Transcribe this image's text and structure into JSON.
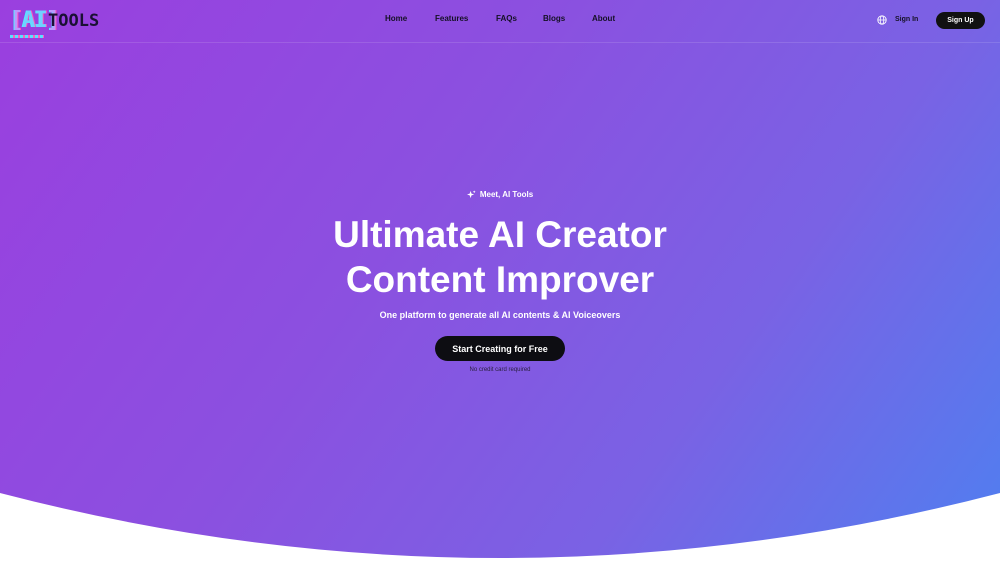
{
  "header": {
    "logo": {
      "mark": "AI",
      "text": "TOOLS"
    },
    "nav": [
      {
        "label": "Home"
      },
      {
        "label": "Features"
      },
      {
        "label": "FAQs"
      },
      {
        "label": "Blogs"
      },
      {
        "label": "About"
      }
    ],
    "language_icon": "globe-icon",
    "sign_in_label": "Sign In",
    "sign_up_label": "Sign Up"
  },
  "hero": {
    "eyebrow": "Meet, AI Tools",
    "eyebrow_icon": "sparkle-icon",
    "headline_line1": "Ultimate AI Creator",
    "headline_line2": "Content Improver",
    "subheadline": "One platform to generate all AI contents & AI Voiceovers",
    "cta_label": "Start Creating for Free",
    "cta_note": "No credit card required"
  },
  "colors": {
    "gradient_start": "#9a3fdf",
    "gradient_end": "#4f7ff0",
    "button_dark": "#111111",
    "text_dark": "#141024"
  }
}
